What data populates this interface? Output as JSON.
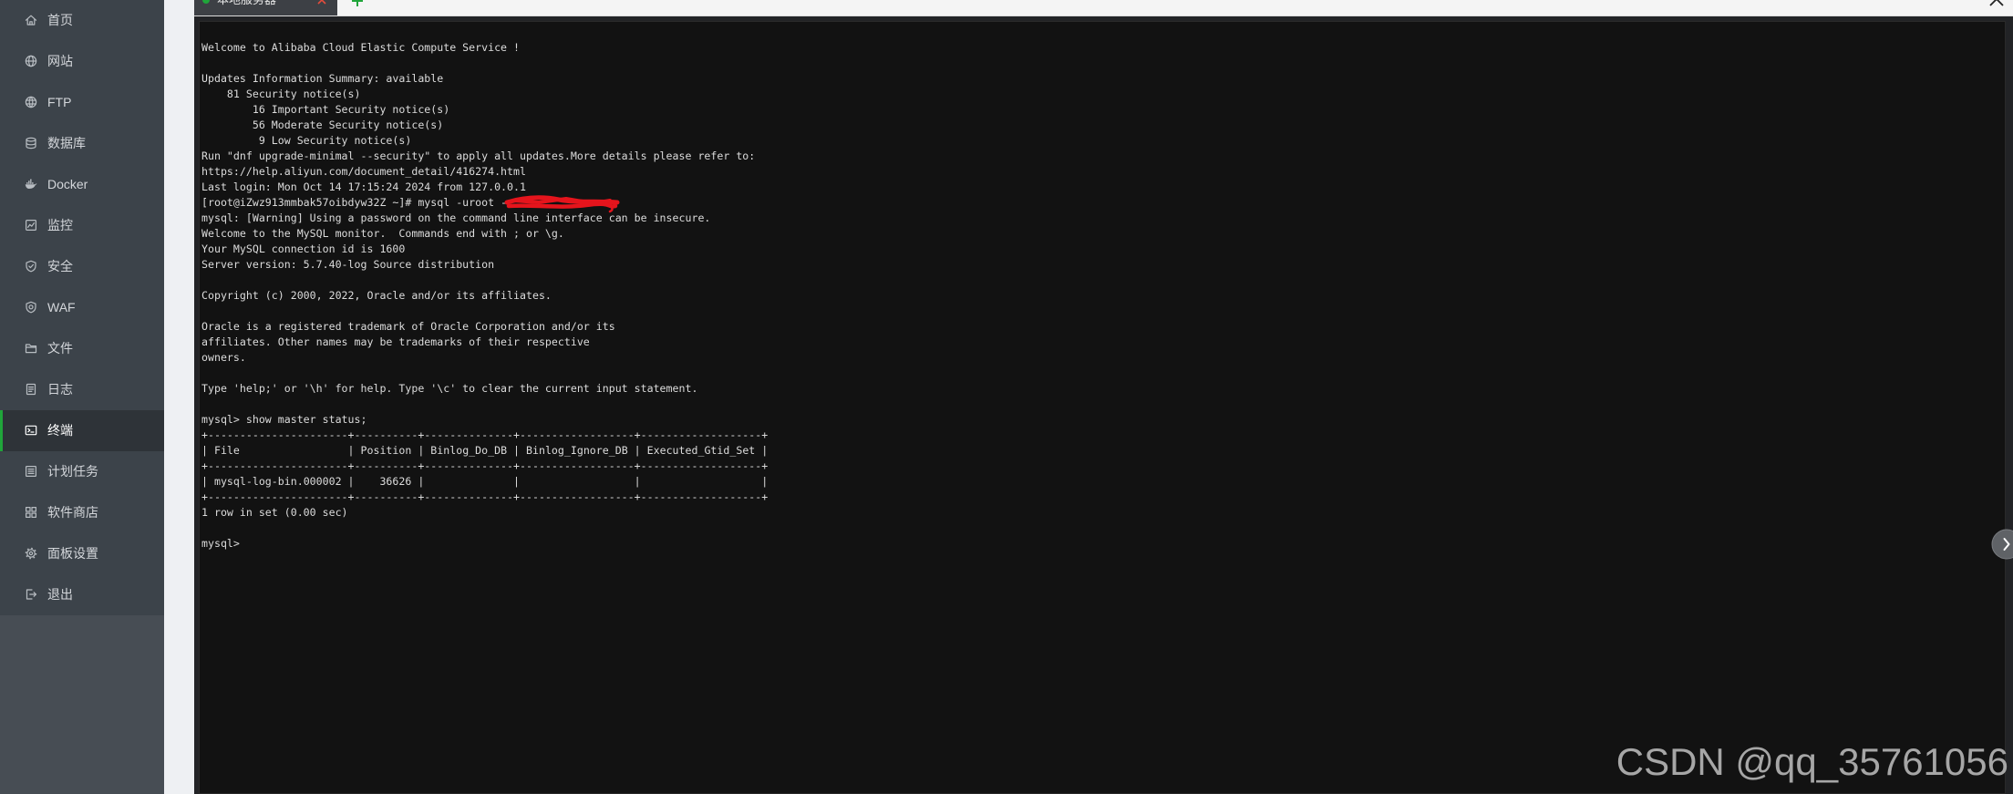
{
  "sidebar": {
    "items": [
      {
        "label": "首页",
        "icon": "home-icon"
      },
      {
        "label": "网站",
        "icon": "globe-icon"
      },
      {
        "label": "FTP",
        "icon": "ftp-icon"
      },
      {
        "label": "数据库",
        "icon": "database-icon"
      },
      {
        "label": "Docker",
        "icon": "docker-icon"
      },
      {
        "label": "监控",
        "icon": "monitor-icon"
      },
      {
        "label": "安全",
        "icon": "shield-icon"
      },
      {
        "label": "WAF",
        "icon": "waf-icon"
      },
      {
        "label": "文件",
        "icon": "folder-icon"
      },
      {
        "label": "日志",
        "icon": "log-icon"
      },
      {
        "label": "终端",
        "icon": "terminal-icon",
        "active": true
      },
      {
        "label": "计划任务",
        "icon": "cron-icon"
      },
      {
        "label": "软件商店",
        "icon": "app-store-icon"
      },
      {
        "label": "面板设置",
        "icon": "settings-icon"
      },
      {
        "label": "退出",
        "icon": "logout-icon"
      }
    ]
  },
  "tabbar": {
    "tabs": [
      {
        "label": "本地服务器",
        "active": true,
        "status_color": "#20a53a",
        "close_icon": "close-icon"
      }
    ],
    "add_icon": "plus-icon",
    "window_close_icon": "close-icon"
  },
  "terminal": {
    "lines_before_table": [
      "Welcome to Alibaba Cloud Elastic Compute Service !",
      "",
      "Updates Information Summary: available",
      "    81 Security notice(s)",
      "        16 Important Security notice(s)",
      "        56 Moderate Security notice(s)",
      "         9 Low Security notice(s)",
      "Run \"dnf upgrade-minimal --security\" to apply all updates.More details please refer to:",
      "https://help.aliyun.com/document_detail/416274.html",
      "Last login: Mon Oct 14 17:15:24 2024 from 127.0.0.1",
      "[root@iZwz913mmbak57oibdyw32Z ~]# mysql -uroot -",
      "mysql: [Warning] Using a password on the command line interface can be insecure.",
      "Welcome to the MySQL monitor.  Commands end with ; or \\g.",
      "Your MySQL connection id is 1600",
      "Server version: 5.7.40-log Source distribution",
      "",
      "Copyright (c) 2000, 2022, Oracle and/or its affiliates.",
      "",
      "Oracle is a registered trademark of Oracle Corporation and/or its",
      "affiliates. Other names may be trademarks of their respective",
      "owners.",
      "",
      "Type 'help;' or '\\h' for help. Type '\\c' to clear the current input statement.",
      "",
      "mysql> show master status;"
    ],
    "result_table": {
      "columns": [
        "File",
        "Position",
        "Binlog_Do_DB",
        "Binlog_Ignore_DB",
        "Executed_Gtid_Set"
      ],
      "rows": [
        [
          "mysql-log-bin.000002",
          "36626",
          "",
          "",
          ""
        ]
      ]
    },
    "lines_after_table": [
      "1 row in set (0.00 sec)",
      "",
      "mysql> "
    ],
    "side_toggle_icon": "chevron-right-icon"
  },
  "watermark": "CSDN @qq_35761056",
  "colors": {
    "accent": "#20a53a",
    "tab_close": "#e64c3c",
    "redaction": "#e5141c",
    "sidebar_bg": "#3c434a",
    "sidebar_active_bg": "#2e3338",
    "terminal_bg": "#121212",
    "terminal_text": "#dcdcdc"
  }
}
